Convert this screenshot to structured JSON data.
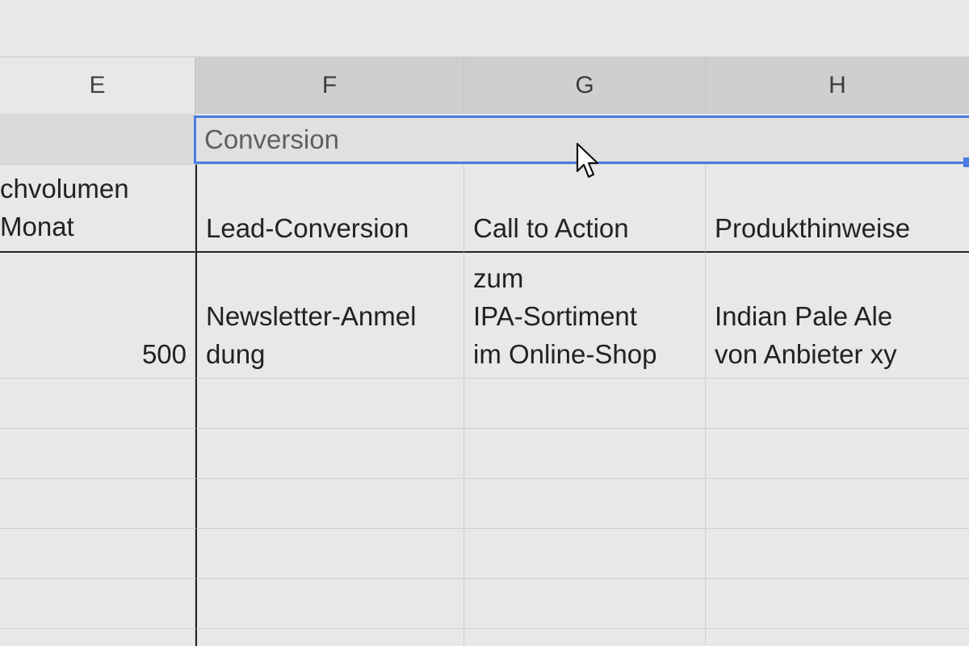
{
  "columns": {
    "e": "E",
    "f": "F",
    "g": "G",
    "h": "H"
  },
  "rows": {
    "group_header": {
      "f_label": "Conversion"
    },
    "headers": {
      "e_label": "chvolumen\n Monat",
      "f_label": "Lead-Conversion",
      "g_label": "Call to Action",
      "h_label": "Produkthinweise"
    },
    "data_1": {
      "e_value": "500",
      "f_value": "Newsletter-Anmel\ndung",
      "g_value": "zum\nIPA-Sortiment\nim Online-Shop",
      "h_value": "Indian Pale Ale\nvon Anbieter xy"
    }
  },
  "colors": {
    "selection": "#4a7be0",
    "grid_line": "#cfcfcf",
    "thick_border": "#222222",
    "background": "#e8e8e8"
  },
  "icons": {
    "cursor": "mouse-pointer-icon"
  }
}
